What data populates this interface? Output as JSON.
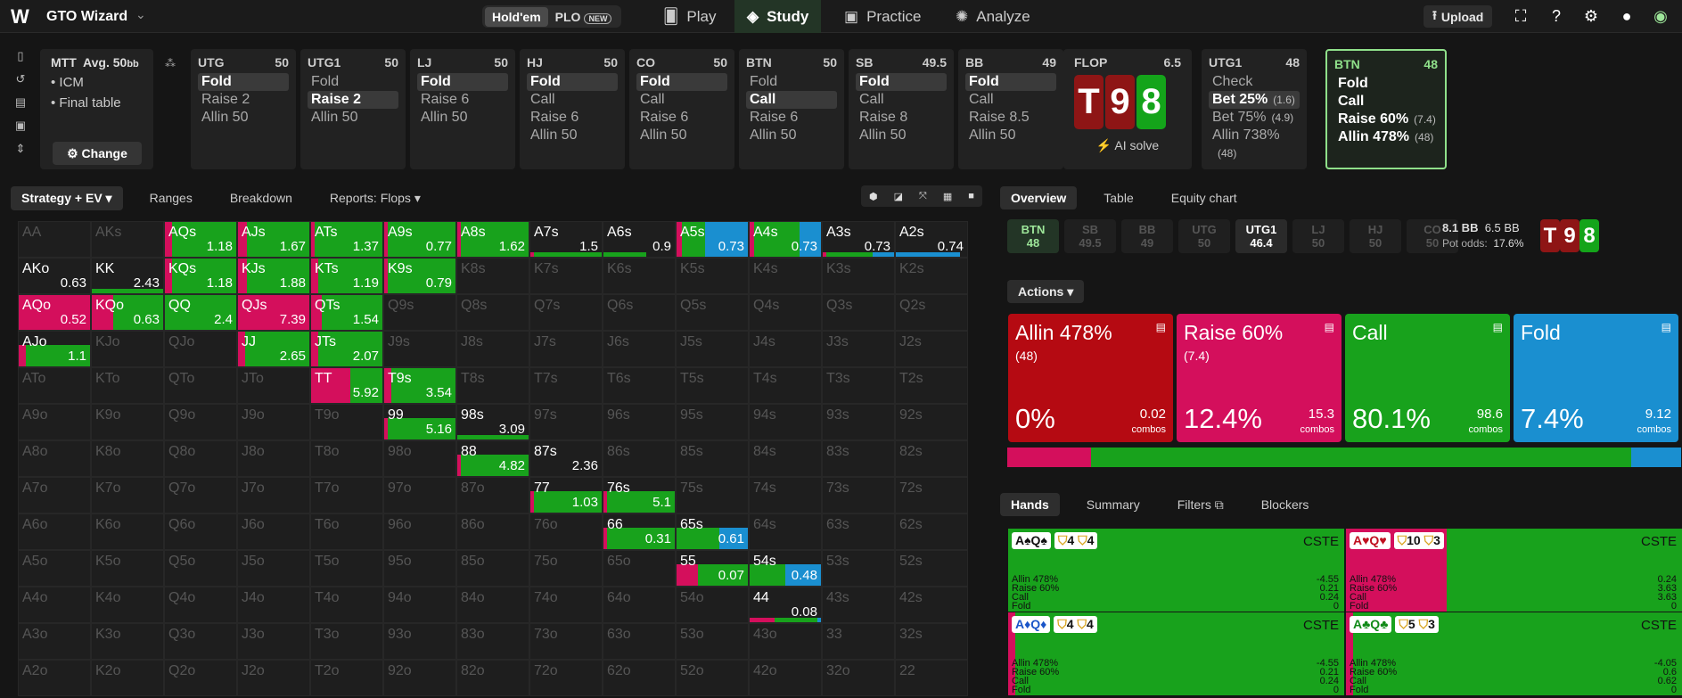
{
  "app": {
    "logo": "W",
    "name": "GTO Wizard"
  },
  "gametypes": [
    {
      "label": "Hold'em",
      "active": true
    },
    {
      "label": "PLO",
      "active": false,
      "badge": "NEW"
    }
  ],
  "nav": [
    {
      "label": "Play",
      "icon": "cards-icon"
    },
    {
      "label": "Study",
      "icon": "study-icon",
      "active": true
    },
    {
      "label": "Practice",
      "icon": "gamepad-icon"
    },
    {
      "label": "Analyze",
      "icon": "bulb-icon"
    }
  ],
  "upload_label": "Upload",
  "mtt": {
    "title": "MTT",
    "avg": "Avg. 50",
    "unit": "bb",
    "lines": [
      "• ICM",
      "• Final table"
    ],
    "change_label": "Change"
  },
  "positions": [
    {
      "name": "UTG",
      "stack": "50",
      "actions": [
        "Fold",
        "Raise 2",
        "Allin 50"
      ],
      "sel": 0
    },
    {
      "name": "UTG1",
      "stack": "50",
      "actions": [
        "Fold",
        "Raise 2",
        "Allin 50"
      ],
      "sel": 1
    },
    {
      "name": "LJ",
      "stack": "50",
      "actions": [
        "Fold",
        "Raise 6",
        "Allin 50"
      ],
      "sel": 0
    },
    {
      "name": "HJ",
      "stack": "50",
      "actions": [
        "Fold",
        "Call",
        "Raise 6",
        "Allin 50"
      ],
      "sel": 0
    },
    {
      "name": "CO",
      "stack": "50",
      "actions": [
        "Fold",
        "Call",
        "Raise 6",
        "Allin 50"
      ],
      "sel": 0
    },
    {
      "name": "BTN",
      "stack": "50",
      "actions": [
        "Fold",
        "Call",
        "Raise 6",
        "Allin 50"
      ],
      "sel": 1
    },
    {
      "name": "SB",
      "stack": "49.5",
      "actions": [
        "Fold",
        "Call",
        "Raise 8",
        "Allin 50"
      ],
      "sel": 0
    },
    {
      "name": "BB",
      "stack": "49",
      "actions": [
        "Fold",
        "Call",
        "Raise 8.5",
        "Allin 50"
      ],
      "sel": 0
    }
  ],
  "flop": {
    "label": "FLOP",
    "pot": "6.5",
    "cards": [
      "T",
      "9",
      "8"
    ],
    "ai": "AI solve"
  },
  "utg1": {
    "name": "UTG1",
    "stack": "48",
    "actions": [
      {
        "l": "Check",
        "s": ""
      },
      {
        "l": "Bet 25%",
        "s": "(1.6)"
      },
      {
        "l": "Bet 75%",
        "s": "(4.9)"
      },
      {
        "l": "Allin 738%",
        "s": "(48)"
      }
    ],
    "sel": 1
  },
  "btn": {
    "name": "BTN",
    "stack": "48",
    "actions": [
      {
        "l": "Fold",
        "s": ""
      },
      {
        "l": "Call",
        "s": ""
      },
      {
        "l": "Raise 60%",
        "s": "(7.4)"
      },
      {
        "l": "Allin 478%",
        "s": "(48)"
      }
    ]
  },
  "tabs": [
    "Strategy + EV",
    "Ranges",
    "Breakdown",
    "Reports: Flops"
  ],
  "colors": {
    "allin": "#b50a12",
    "raise": "#d40f5c",
    "call": "#18a21c",
    "fold": "#1a8fd0",
    "empty": "#1e1e1e"
  },
  "grid": [
    [
      [
        "AA",
        0,
        0,
        0,
        ""
      ],
      [
        "AKs",
        0,
        0,
        0,
        ""
      ],
      [
        "AQs",
        0.1,
        0,
        0.9,
        "1.18"
      ],
      [
        "AJs",
        0.12,
        0,
        0.88,
        "1.67"
      ],
      [
        "ATs",
        0.05,
        0,
        0.95,
        "1.37"
      ],
      [
        "A9s",
        0.05,
        0,
        0.95,
        "0.77"
      ],
      [
        "A8s",
        0.05,
        0,
        0.95,
        "1.62"
      ],
      [
        "A7s",
        0.05,
        0,
        0.95,
        "1.5",
        "low"
      ],
      [
        "A6s",
        0.0,
        0,
        0.6,
        "0.9",
        "low"
      ],
      [
        "A5s",
        0.08,
        0.6,
        0.32,
        "0.73"
      ],
      [
        "A4s",
        0.06,
        0.3,
        0.64,
        "0.73"
      ],
      [
        "A3s",
        0.05,
        0.3,
        0.65,
        "0.73",
        "low"
      ],
      [
        "A2s",
        0.0,
        0.9,
        0,
        "0.74",
        "low"
      ]
    ],
    [
      [
        "AKo",
        0,
        0,
        0,
        "0.63",
        "on"
      ],
      [
        "KK",
        0,
        0,
        1,
        "2.43",
        "low"
      ],
      [
        "KQs",
        0.1,
        0,
        0.9,
        "1.18"
      ],
      [
        "KJs",
        0.12,
        0,
        0.88,
        "1.88"
      ],
      [
        "KTs",
        0.1,
        0,
        0.9,
        "1.19"
      ],
      [
        "K9s",
        0.05,
        0,
        0.95,
        "0.79"
      ],
      [
        "K8s",
        0,
        0,
        0,
        ""
      ],
      [
        "K7s",
        0,
        0,
        0,
        ""
      ],
      [
        "K6s",
        0,
        0,
        0,
        ""
      ],
      [
        "K5s",
        0,
        0,
        0,
        ""
      ],
      [
        "K4s",
        0,
        0,
        0,
        ""
      ],
      [
        "K3s",
        0,
        0,
        0,
        ""
      ],
      [
        "K2s",
        0,
        0,
        0,
        ""
      ]
    ],
    [
      [
        "AQo",
        1,
        0,
        0,
        "0.52",
        "mix"
      ],
      [
        "KQo",
        0.3,
        0,
        0.7,
        "0.63"
      ],
      [
        "QQ",
        0,
        0,
        1,
        "2.4"
      ],
      [
        "QJs",
        1,
        0,
        0,
        "7.39",
        "mix"
      ],
      [
        "QTs",
        0.15,
        0,
        0.85,
        "1.54"
      ],
      [
        "Q9s",
        0,
        0,
        0,
        ""
      ],
      [
        "Q8s",
        0,
        0,
        0,
        ""
      ],
      [
        "Q7s",
        0,
        0,
        0,
        ""
      ],
      [
        "Q6s",
        0,
        0,
        0,
        ""
      ],
      [
        "Q5s",
        0,
        0,
        0,
        ""
      ],
      [
        "Q4s",
        0,
        0,
        0,
        ""
      ],
      [
        "Q3s",
        0,
        0,
        0,
        ""
      ],
      [
        "Q2s",
        0,
        0,
        0,
        ""
      ]
    ],
    [
      [
        "AJo",
        0.1,
        0,
        0.9,
        "1.1",
        "half"
      ],
      [
        "KJo",
        0,
        0,
        0,
        ""
      ],
      [
        "QJo",
        0,
        0,
        0,
        ""
      ],
      [
        "JJ",
        0.1,
        0,
        0.9,
        "2.65"
      ],
      [
        "JTs",
        0.1,
        0,
        0.9,
        "2.07"
      ],
      [
        "J9s",
        0,
        0,
        0,
        ""
      ],
      [
        "J8s",
        0,
        0,
        0,
        ""
      ],
      [
        "J7s",
        0,
        0,
        0,
        ""
      ],
      [
        "J6s",
        0,
        0,
        0,
        ""
      ],
      [
        "J5s",
        0,
        0,
        0,
        ""
      ],
      [
        "J4s",
        0,
        0,
        0,
        ""
      ],
      [
        "J3s",
        0,
        0,
        0,
        ""
      ],
      [
        "J2s",
        0,
        0,
        0,
        ""
      ]
    ],
    [
      [
        "ATo",
        0,
        0,
        0,
        ""
      ],
      [
        "KTo",
        0,
        0,
        0,
        ""
      ],
      [
        "QTo",
        0,
        0,
        0,
        ""
      ],
      [
        "JTo",
        0,
        0,
        0,
        ""
      ],
      [
        "TT",
        0.55,
        0,
        0.45,
        "5.92"
      ],
      [
        "T9s",
        0.1,
        0,
        0.9,
        "3.54"
      ],
      [
        "T8s",
        0,
        0,
        0,
        ""
      ],
      [
        "T7s",
        0,
        0,
        0,
        ""
      ],
      [
        "T6s",
        0,
        0,
        0,
        ""
      ],
      [
        "T5s",
        0,
        0,
        0,
        ""
      ],
      [
        "T4s",
        0,
        0,
        0,
        ""
      ],
      [
        "T3s",
        0,
        0,
        0,
        ""
      ],
      [
        "T2s",
        0,
        0,
        0,
        ""
      ]
    ],
    [
      [
        "A9o",
        0,
        0,
        0,
        ""
      ],
      [
        "K9o",
        0,
        0,
        0,
        ""
      ],
      [
        "Q9o",
        0,
        0,
        0,
        ""
      ],
      [
        "J9o",
        0,
        0,
        0,
        ""
      ],
      [
        "T9o",
        0,
        0,
        0,
        ""
      ],
      [
        "99",
        0.05,
        0,
        0.95,
        "5.16",
        "half"
      ],
      [
        "98s",
        0,
        0,
        1,
        "3.09",
        "low"
      ],
      [
        "97s",
        0,
        0,
        0,
        ""
      ],
      [
        "96s",
        0,
        0,
        0,
        ""
      ],
      [
        "95s",
        0,
        0,
        0,
        ""
      ],
      [
        "94s",
        0,
        0,
        0,
        ""
      ],
      [
        "93s",
        0,
        0,
        0,
        ""
      ],
      [
        "92s",
        0,
        0,
        0,
        ""
      ]
    ],
    [
      [
        "A8o",
        0,
        0,
        0,
        ""
      ],
      [
        "K8o",
        0,
        0,
        0,
        ""
      ],
      [
        "Q8o",
        0,
        0,
        0,
        ""
      ],
      [
        "J8o",
        0,
        0,
        0,
        ""
      ],
      [
        "T8o",
        0,
        0,
        0,
        ""
      ],
      [
        "98o",
        0,
        0,
        0,
        ""
      ],
      [
        "88",
        0.05,
        0,
        0.95,
        "4.82",
        "half"
      ],
      [
        "87s",
        0,
        0,
        0,
        "2.36",
        "on"
      ],
      [
        "86s",
        0,
        0,
        0,
        ""
      ],
      [
        "85s",
        0,
        0,
        0,
        ""
      ],
      [
        "84s",
        0,
        0,
        0,
        ""
      ],
      [
        "83s",
        0,
        0,
        0,
        ""
      ],
      [
        "82s",
        0,
        0,
        0,
        ""
      ]
    ],
    [
      [
        "A7o",
        0,
        0,
        0,
        ""
      ],
      [
        "K7o",
        0,
        0,
        0,
        ""
      ],
      [
        "Q7o",
        0,
        0,
        0,
        ""
      ],
      [
        "J7o",
        0,
        0,
        0,
        ""
      ],
      [
        "T7o",
        0,
        0,
        0,
        ""
      ],
      [
        "97o",
        0,
        0,
        0,
        ""
      ],
      [
        "87o",
        0,
        0,
        0,
        ""
      ],
      [
        "77",
        0.05,
        0,
        0.95,
        "1.03",
        "half"
      ],
      [
        "76s",
        0.05,
        0,
        0.95,
        "5.1",
        "half"
      ],
      [
        "75s",
        0,
        0,
        0,
        ""
      ],
      [
        "74s",
        0,
        0,
        0,
        ""
      ],
      [
        "73s",
        0,
        0,
        0,
        ""
      ],
      [
        "72s",
        0,
        0,
        0,
        ""
      ]
    ],
    [
      [
        "A6o",
        0,
        0,
        0,
        ""
      ],
      [
        "K6o",
        0,
        0,
        0,
        ""
      ],
      [
        "Q6o",
        0,
        0,
        0,
        ""
      ],
      [
        "J6o",
        0,
        0,
        0,
        ""
      ],
      [
        "T6o",
        0,
        0,
        0,
        ""
      ],
      [
        "96o",
        0,
        0,
        0,
        ""
      ],
      [
        "86o",
        0,
        0,
        0,
        ""
      ],
      [
        "76o",
        0,
        0,
        0,
        ""
      ],
      [
        "66",
        0.05,
        0,
        0.95,
        "0.31",
        "half"
      ],
      [
        "65s",
        0,
        0.4,
        0.6,
        "0.61",
        "half"
      ],
      [
        "64s",
        0,
        0,
        0,
        ""
      ],
      [
        "63s",
        0,
        0,
        0,
        ""
      ],
      [
        "62s",
        0,
        0,
        0,
        ""
      ]
    ],
    [
      [
        "A5o",
        0,
        0,
        0,
        ""
      ],
      [
        "K5o",
        0,
        0,
        0,
        ""
      ],
      [
        "Q5o",
        0,
        0,
        0,
        ""
      ],
      [
        "J5o",
        0,
        0,
        0,
        ""
      ],
      [
        "T5o",
        0,
        0,
        0,
        ""
      ],
      [
        "95o",
        0,
        0,
        0,
        ""
      ],
      [
        "85o",
        0,
        0,
        0,
        ""
      ],
      [
        "75o",
        0,
        0,
        0,
        ""
      ],
      [
        "65o",
        0,
        0,
        0,
        ""
      ],
      [
        "55",
        0.3,
        0,
        0.7,
        "0.07",
        "half"
      ],
      [
        "54s",
        0,
        0.5,
        0.5,
        "0.48",
        "half"
      ],
      [
        "53s",
        0,
        0,
        0,
        ""
      ],
      [
        "52s",
        0,
        0,
        0,
        ""
      ]
    ],
    [
      [
        "A4o",
        0,
        0,
        0,
        ""
      ],
      [
        "K4o",
        0,
        0,
        0,
        ""
      ],
      [
        "Q4o",
        0,
        0,
        0,
        ""
      ],
      [
        "J4o",
        0,
        0,
        0,
        ""
      ],
      [
        "T4o",
        0,
        0,
        0,
        ""
      ],
      [
        "94o",
        0,
        0,
        0,
        ""
      ],
      [
        "84o",
        0,
        0,
        0,
        ""
      ],
      [
        "74o",
        0,
        0,
        0,
        ""
      ],
      [
        "64o",
        0,
        0,
        0,
        ""
      ],
      [
        "54o",
        0,
        0,
        0,
        ""
      ],
      [
        "44",
        0.35,
        0.05,
        0.6,
        "0.08",
        "low"
      ],
      [
        "43s",
        0,
        0,
        0,
        ""
      ],
      [
        "42s",
        0,
        0,
        0,
        ""
      ]
    ],
    [
      [
        "A3o",
        0,
        0,
        0,
        ""
      ],
      [
        "K3o",
        0,
        0,
        0,
        ""
      ],
      [
        "Q3o",
        0,
        0,
        0,
        ""
      ],
      [
        "J3o",
        0,
        0,
        0,
        ""
      ],
      [
        "T3o",
        0,
        0,
        0,
        ""
      ],
      [
        "93o",
        0,
        0,
        0,
        ""
      ],
      [
        "83o",
        0,
        0,
        0,
        ""
      ],
      [
        "73o",
        0,
        0,
        0,
        ""
      ],
      [
        "63o",
        0,
        0,
        0,
        ""
      ],
      [
        "53o",
        0,
        0,
        0,
        ""
      ],
      [
        "43o",
        0,
        0,
        0,
        ""
      ],
      [
        "33",
        0,
        0,
        0,
        ""
      ],
      [
        "32s",
        0,
        0,
        0,
        ""
      ]
    ],
    [
      [
        "A2o",
        0,
        0,
        0,
        ""
      ],
      [
        "K2o",
        0,
        0,
        0,
        ""
      ],
      [
        "Q2o",
        0,
        0,
        0,
        ""
      ],
      [
        "J2o",
        0,
        0,
        0,
        ""
      ],
      [
        "T2o",
        0,
        0,
        0,
        ""
      ],
      [
        "92o",
        0,
        0,
        0,
        ""
      ],
      [
        "82o",
        0,
        0,
        0,
        ""
      ],
      [
        "72o",
        0,
        0,
        0,
        ""
      ],
      [
        "62o",
        0,
        0,
        0,
        ""
      ],
      [
        "52o",
        0,
        0,
        0,
        ""
      ],
      [
        "42o",
        0,
        0,
        0,
        ""
      ],
      [
        "32o",
        0,
        0,
        0,
        ""
      ],
      [
        "22",
        0,
        0,
        0,
        ""
      ]
    ]
  ],
  "overview_tabs": [
    "Overview",
    "Table",
    "Equity chart"
  ],
  "pos_strip": [
    {
      "n": "BTN",
      "s": "48",
      "st": "active1"
    },
    {
      "n": "SB",
      "s": "49.5"
    },
    {
      "n": "BB",
      "s": "49"
    },
    {
      "n": "UTG",
      "s": "50"
    },
    {
      "n": "UTG1",
      "s": "46.4",
      "st": "active2"
    },
    {
      "n": "LJ",
      "s": "50"
    },
    {
      "n": "HJ",
      "s": "50"
    },
    {
      "n": "CO",
      "s": "50"
    }
  ],
  "pot": {
    "a": "8.1 BB",
    "b": "6.5 BB",
    "odds_label": "Pot odds:",
    "odds": "17.6%"
  },
  "actions_label": "Actions",
  "action_boxes": [
    {
      "title": "Allin 478%",
      "sub": "(48)",
      "pct": "0%",
      "combos": "0.02",
      "combos_label": "combos",
      "color": "#b50a12"
    },
    {
      "title": "Raise 60%",
      "sub": "(7.4)",
      "pct": "12.4%",
      "combos": "15.3",
      "combos_label": "combos",
      "color": "#d40f5c"
    },
    {
      "title": "Call",
      "sub": "",
      "pct": "80.1%",
      "combos": "98.6",
      "combos_label": "combos",
      "color": "#18a21c"
    },
    {
      "title": "Fold",
      "sub": "",
      "pct": "7.4%",
      "combos": "9.12",
      "combos_label": "combos",
      "color": "#1a8fd0"
    }
  ],
  "freq": [
    0,
    12.4,
    80.1,
    7.4
  ],
  "hand_tabs": [
    "Hands",
    "Summary",
    "Filters",
    "Blockers"
  ],
  "hands": [
    {
      "combo": "A♠Q♠",
      "badges": [
        "4",
        "4"
      ],
      "cste": "CSTE",
      "lines": [
        [
          "Allin 478%",
          "-4.55"
        ],
        [
          "Raise 60%",
          "0.21"
        ],
        [
          "Call",
          "0.24"
        ],
        [
          "Fold",
          "0"
        ]
      ],
      "mix": [
        0,
        0,
        1,
        0
      ]
    },
    {
      "combo": "A♥Q♥",
      "badges": [
        "10",
        "3"
      ],
      "cste": "CSTE",
      "lines": [
        [
          "Allin 478%",
          "0.24"
        ],
        [
          "Raise 60%",
          "3.63"
        ],
        [
          "Call",
          "3.63"
        ],
        [
          "Fold",
          "0"
        ]
      ],
      "mix": [
        0,
        0.3,
        0.7,
        0
      ]
    },
    {
      "combo": "A♦Q♦",
      "badges": [
        "4",
        "4"
      ],
      "cste": "CSTE",
      "lines": [
        [
          "Allin 478%",
          "-4.55"
        ],
        [
          "Raise 60%",
          "0.21"
        ],
        [
          "Call",
          "0.24"
        ],
        [
          "Fold",
          "0"
        ]
      ],
      "mix": [
        0,
        0.02,
        0.98,
        0
      ]
    },
    {
      "combo": "A♣Q♣",
      "badges": [
        "5",
        "3"
      ],
      "cste": "CSTE",
      "lines": [
        [
          "Allin 478%",
          "-4.05"
        ],
        [
          "Raise 60%",
          "0.6"
        ],
        [
          "Call",
          "0.62"
        ],
        [
          "Fold",
          "0"
        ]
      ],
      "mix": [
        0,
        0.02,
        0.98,
        0
      ]
    }
  ]
}
